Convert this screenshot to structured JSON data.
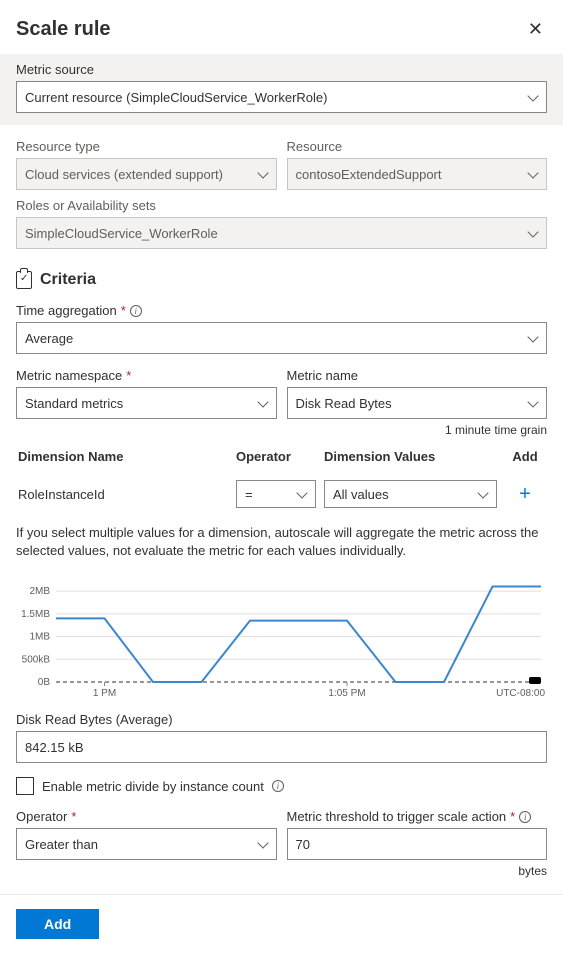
{
  "header": {
    "title": "Scale rule"
  },
  "metric_source": {
    "label": "Metric source",
    "value": "Current resource (SimpleCloudService_WorkerRole)"
  },
  "resource_type": {
    "label": "Resource type",
    "value": "Cloud services (extended support)"
  },
  "resource": {
    "label": "Resource",
    "value": "contosoExtendedSupport"
  },
  "roles": {
    "label": "Roles or Availability sets",
    "value": "SimpleCloudService_WorkerRole"
  },
  "criteria": {
    "title": "Criteria"
  },
  "time_agg": {
    "label": "Time aggregation",
    "value": "Average"
  },
  "metric_ns": {
    "label": "Metric namespace",
    "value": "Standard metrics"
  },
  "metric_name": {
    "label": "Metric name",
    "value": "Disk Read Bytes"
  },
  "time_grain": "1 minute time grain",
  "dim": {
    "head_name": "Dimension Name",
    "head_op": "Operator",
    "head_vals": "Dimension Values",
    "head_add": "Add",
    "row_name": "RoleInstanceId",
    "row_op": "=",
    "row_vals": "All values"
  },
  "help_text": "If you select multiple values for a dimension, autoscale will aggregate the metric across the selected values, not evaluate the metric for each values individually.",
  "chart_data": {
    "type": "line",
    "title": "",
    "xlabel": "",
    "ylabel": "",
    "x": [
      "12:55 PM",
      "1 PM",
      "1:01 PM",
      "1:02 PM",
      "1:03 PM",
      "1:04 PM",
      "1:05 PM",
      "1:06 PM",
      "1:07 PM",
      "1:08 PM",
      "1:09 PM"
    ],
    "values_bytes": [
      1400000,
      1400000,
      0,
      0,
      1350000,
      1350000,
      1350000,
      0,
      0,
      2100000,
      2100000
    ],
    "ylim_bytes": [
      0,
      2200000
    ],
    "y_ticks": [
      "0B",
      "500kB",
      "1MB",
      "1.5MB",
      "2MB"
    ],
    "x_ticks": [
      "1 PM",
      "1:05 PM"
    ],
    "tz": "UTC-08:00"
  },
  "readout": {
    "label": "Disk Read Bytes (Average)",
    "value": "842.15 kB"
  },
  "divide_chk": {
    "label": "Enable metric divide by instance count"
  },
  "operator": {
    "label": "Operator",
    "value": "Greater than"
  },
  "threshold": {
    "label": "Metric threshold to trigger scale action",
    "value": "70",
    "unit": "bytes"
  },
  "footer": {
    "add": "Add"
  }
}
